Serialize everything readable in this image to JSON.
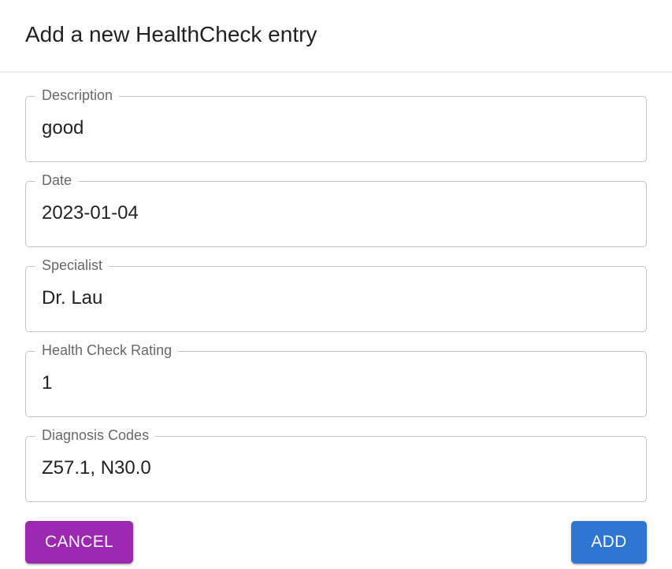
{
  "dialog": {
    "title": "Add a new HealthCheck entry"
  },
  "fields": [
    {
      "label": "Description",
      "value": "good"
    },
    {
      "label": "Date",
      "value": "2023-01-04"
    },
    {
      "label": "Specialist",
      "value": "Dr. Lau"
    },
    {
      "label": "Health Check Rating",
      "value": "1"
    },
    {
      "label": "Diagnosis Codes",
      "value": "Z57.1, N30.0"
    }
  ],
  "actions": {
    "cancel_label": "Cancel",
    "add_label": "Add"
  },
  "colors": {
    "cancel": "#9c27b0",
    "add": "#2e76d2",
    "border": "#c4c4c4",
    "divider": "#e0e0e0"
  }
}
